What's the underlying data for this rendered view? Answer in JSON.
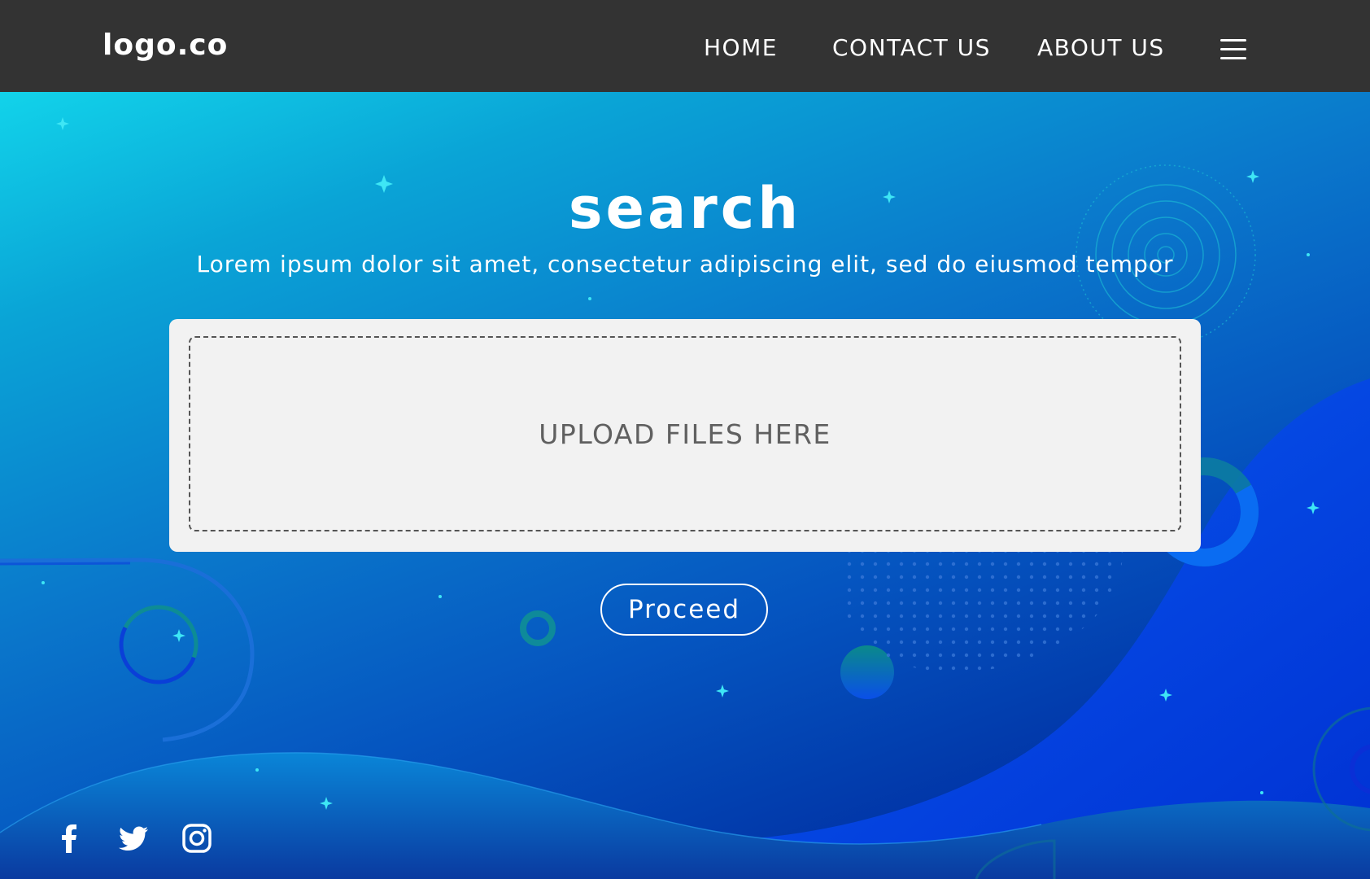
{
  "header": {
    "logo": "logo.co",
    "nav": [
      {
        "label": "HOME"
      },
      {
        "label": "CONTACT US"
      },
      {
        "label": "ABOUT US"
      }
    ],
    "menu_icon": "hamburger-menu-icon"
  },
  "hero": {
    "title": "search",
    "subtitle": "Lorem ipsum dolor sit amet, consectetur adipiscing elit, sed do eiusmod tempor",
    "upload_label": "UPLOAD FILES HERE",
    "proceed_label": "Proceed"
  },
  "social": [
    {
      "icon": "facebook-icon"
    },
    {
      "icon": "twitter-icon"
    },
    {
      "icon": "instagram-icon"
    }
  ],
  "colors": {
    "header_bg": "#333333",
    "text": "#ffffff",
    "upload_bg": "#f2f2f2",
    "upload_text": "#606060",
    "gradient_start": "#12d3ea",
    "gradient_end": "#012e8e"
  }
}
